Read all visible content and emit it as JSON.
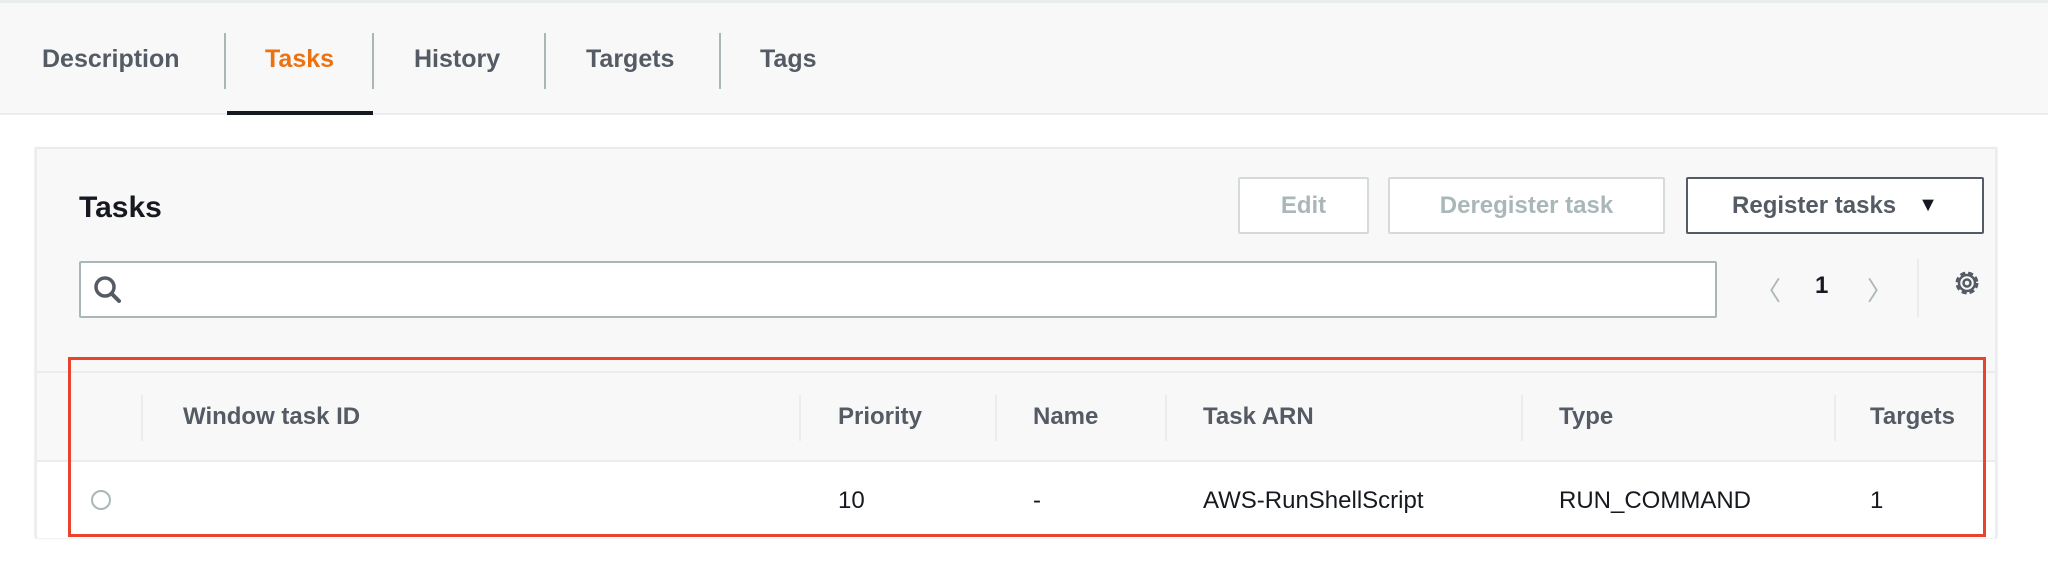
{
  "tabs": [
    {
      "label": "Description"
    },
    {
      "label": "Tasks",
      "active": true
    },
    {
      "label": "History"
    },
    {
      "label": "Targets"
    },
    {
      "label": "Tags"
    }
  ],
  "panel": {
    "title": "Tasks",
    "edit_label": "Edit",
    "deregister_label": "Deregister task",
    "register_label": "Register tasks",
    "search_placeholder": "",
    "page": "1"
  },
  "table": {
    "columns": [
      "Window task ID",
      "Priority",
      "Name",
      "Task ARN",
      "Type",
      "Targets"
    ],
    "rows": [
      {
        "window_task_id": "",
        "priority": "10",
        "name": "-",
        "task_arn": "AWS-RunShellScript",
        "type": "RUN_COMMAND",
        "targets": "1"
      }
    ]
  },
  "colors": {
    "accent": "#ec7211",
    "highlight": "#e8432c"
  }
}
